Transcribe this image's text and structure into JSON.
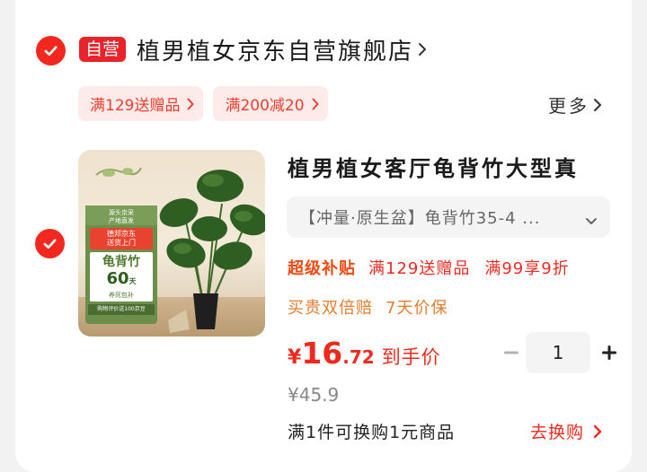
{
  "shop": {
    "badge": "自营",
    "name": "植男植女京东自营旗舰店",
    "promos": [
      "满129送赠品",
      "满200减20"
    ],
    "more": "更多"
  },
  "product": {
    "image_texts": {
      "top": "源头京采\n产地直发",
      "delivery": "德邦京东\n送货上门",
      "name": "龟背竹",
      "days": "60",
      "days_unit": "天",
      "guarantee": "养死包补",
      "footer": "购物评价送100京豆"
    },
    "title": "植男植女客厅龟背竹大型真",
    "spec": "【冲量·原生盆】龟背竹35-4 ...",
    "tags_row1": {
      "super": "超级补贴",
      "items": [
        "满129送赠品",
        "满99享9折"
      ]
    },
    "tags_row2": [
      "买贵双倍赔",
      "7天价保"
    ],
    "price": {
      "currency": "¥",
      "integer": "16",
      "decimal": ".72",
      "label": "到手价"
    },
    "original_price": "¥45.9",
    "quantity": "1",
    "swap_text": "满1件可换购1元商品",
    "swap_link": "去换购"
  },
  "colors": {
    "accent_red": "#f2271e",
    "promo_bg": "#fcebe8",
    "orange_tag": "#e57c2e"
  }
}
